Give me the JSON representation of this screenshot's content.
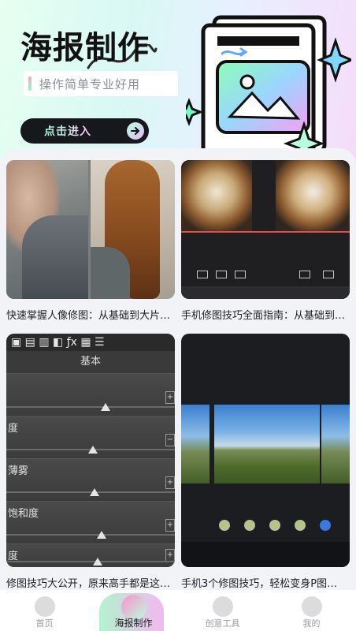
{
  "banner": {
    "title": "海报制作",
    "subtitle": "操作简单专业好用",
    "enter_label": "点击进入"
  },
  "cards": [
    {
      "caption": "快速掌握人像修图：从基础到大片…"
    },
    {
      "caption": "手机修图技巧全面指南：从基础到…"
    },
    {
      "caption": "修图技巧大公开，原来高手都是这…"
    },
    {
      "caption": "手机3个修图技巧，轻松变身P图…"
    }
  ],
  "editor": {
    "panel_title": "基本",
    "rows": [
      {
        "label": ""
      },
      {
        "label": "度"
      },
      {
        "label": "薄雾"
      },
      {
        "label": "饱和度"
      },
      {
        "label": "度"
      }
    ]
  },
  "tabbar": {
    "items": [
      {
        "label": "首页",
        "icon": "home-icon",
        "active": false
      },
      {
        "label": "海报制作",
        "icon": "poster-icon",
        "active": true
      },
      {
        "label": "创意工具",
        "icon": "tools-icon",
        "active": false
      },
      {
        "label": "我的",
        "icon": "profile-icon",
        "active": false
      }
    ]
  },
  "colors": {
    "accent_green": "#b2f3cf",
    "accent_pink": "#f3b8f0",
    "button_dark": "#16181c"
  }
}
